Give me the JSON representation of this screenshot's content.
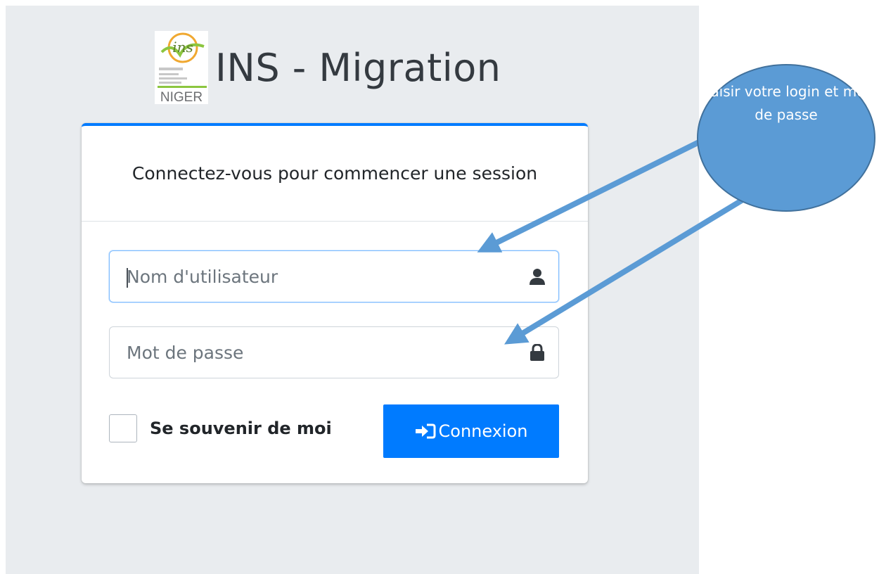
{
  "brand": {
    "title": "INS - Migration",
    "logo_caption": "NIGER",
    "logo_monogram": "ins"
  },
  "login": {
    "message": "Connectez-vous pour commencer une session",
    "username": {
      "placeholder": "Nom d'utilisateur",
      "value": "",
      "icon": "user-icon"
    },
    "password": {
      "placeholder": "Mot de passe",
      "value": "",
      "icon": "lock-icon"
    },
    "remember_label": "Se souvenir de moi",
    "remember_checked": false,
    "submit_label": "Connexion",
    "submit_icon": "sign-in-icon"
  },
  "annotation": {
    "callout_text": "Saisir votre login et mot de passe"
  },
  "colors": {
    "primary": "#007bff",
    "background": "#e9ecef",
    "callout_fill": "#5b9bd5",
    "callout_border": "#41719c"
  }
}
